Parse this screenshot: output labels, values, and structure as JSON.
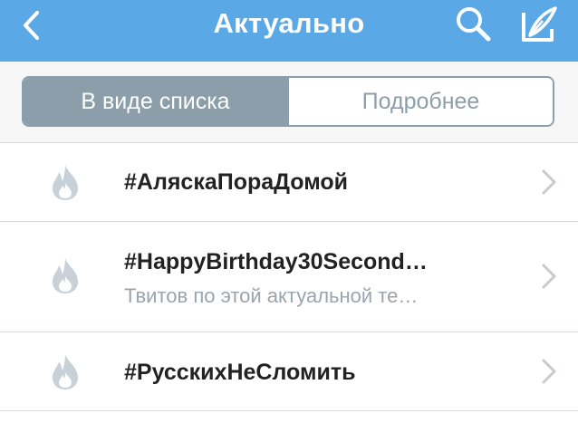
{
  "navbar": {
    "title": "Актуально",
    "back_icon": "chevron-left-icon",
    "search_icon": "search-icon",
    "compose_icon": "compose-quill-icon",
    "background_color": "#5aa9e6"
  },
  "segmented": {
    "list_label": "В виде списка",
    "detail_label": "Подробнее",
    "selected": "list",
    "active_color": "#8c9eaa"
  },
  "trends": [
    {
      "icon": "flame-icon",
      "title": "#АляскаПораДомой",
      "subtitle": ""
    },
    {
      "icon": "flame-icon",
      "title": "#HappyBirthday30Second…",
      "subtitle": "Твитов по этой актуальной те…"
    },
    {
      "icon": "flame-icon",
      "title": "#РусскихНеСломить",
      "subtitle": ""
    }
  ]
}
